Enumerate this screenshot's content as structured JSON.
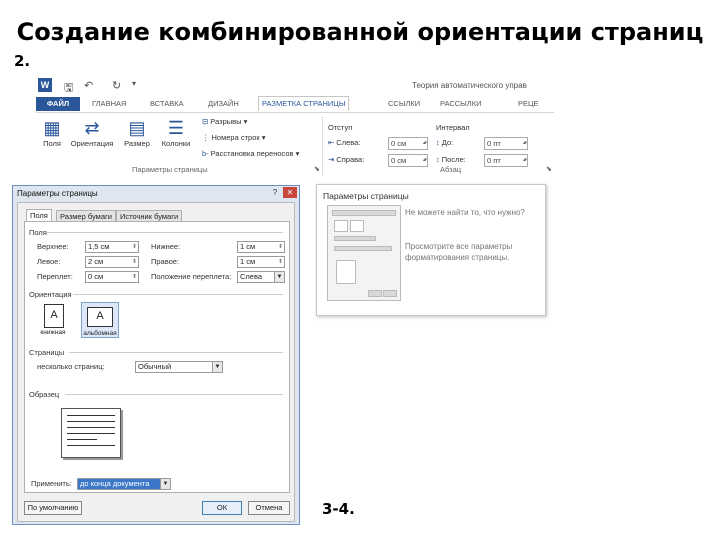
{
  "slide": {
    "title": "Создание комбинированной ориентации страниц",
    "step_2": "2.",
    "step_3_4": "3-4."
  },
  "ribbon": {
    "document_title": "Теория автоматического управ",
    "tabs": [
      "ФАЙЛ",
      "ГЛАВНАЯ",
      "ВСТАВКА",
      "ДИЗАЙН",
      "РАЗМЕТКА СТРАНИЦЫ",
      "ССЫЛКИ",
      "РАССЫЛКИ",
      "РЕЦЕ"
    ],
    "active_tab": "РАЗМЕТКА СТРАНИЦЫ",
    "buttons": {
      "fields": "Поля",
      "orientation": "Ориентация",
      "size": "Размер",
      "columns": "Колонки",
      "breaks": "Разрывы",
      "line_numbers": "Номера строк",
      "hyphenation": "Расстановка переносов"
    },
    "indent_label": "Отступ",
    "spacing_label": "Интервал",
    "indent_left_label": "Слева:",
    "indent_left_value": "0 см",
    "indent_right_label": "Справа:",
    "indent_right_value": "0 см",
    "spacing_before_label": "До:",
    "spacing_before_value": "0 пт",
    "spacing_after_label": "После:",
    "spacing_after_value": "0 пт",
    "group_page_setup": "Параметры страницы",
    "group_paragraph": "Абзац"
  },
  "tooltip": {
    "title": "Параметры страницы",
    "text1": "Не можете найти то, что нужно?",
    "text2": "Просмотрите все параметры форматирования страницы."
  },
  "dialog": {
    "title": "Параметры страницы",
    "tabs": [
      "Поля",
      "Размер бумаги",
      "Источник бумаги"
    ],
    "active_tab": "Поля",
    "section_margins": "Поля",
    "top_label": "Верхнее:",
    "top_value": "1,5 см",
    "bottom_label": "Нижнее:",
    "bottom_value": "1 см",
    "left_label": "Левое:",
    "left_value": "2 см",
    "right_label": "Правое:",
    "right_value": "1 см",
    "gutter_label": "Переплет:",
    "gutter_value": "0 см",
    "gutter_pos_label": "Положение переплета:",
    "gutter_pos_value": "Слева",
    "section_orientation": "Ориентация",
    "portrait_label": "книжная",
    "landscape_label": "альбомная",
    "section_pages": "Страницы",
    "multiple_pages_label": "несколько страниц:",
    "multiple_pages_value": "Обычный",
    "section_sample": "Образец",
    "apply_label": "Применить:",
    "apply_value": "до конца документа",
    "default_button": "По умолчанию",
    "ok_button": "ОК",
    "cancel_button": "Отмена"
  },
  "colors": {
    "word_blue": "#2b579a",
    "dialog_border": "#6d8fbf"
  }
}
